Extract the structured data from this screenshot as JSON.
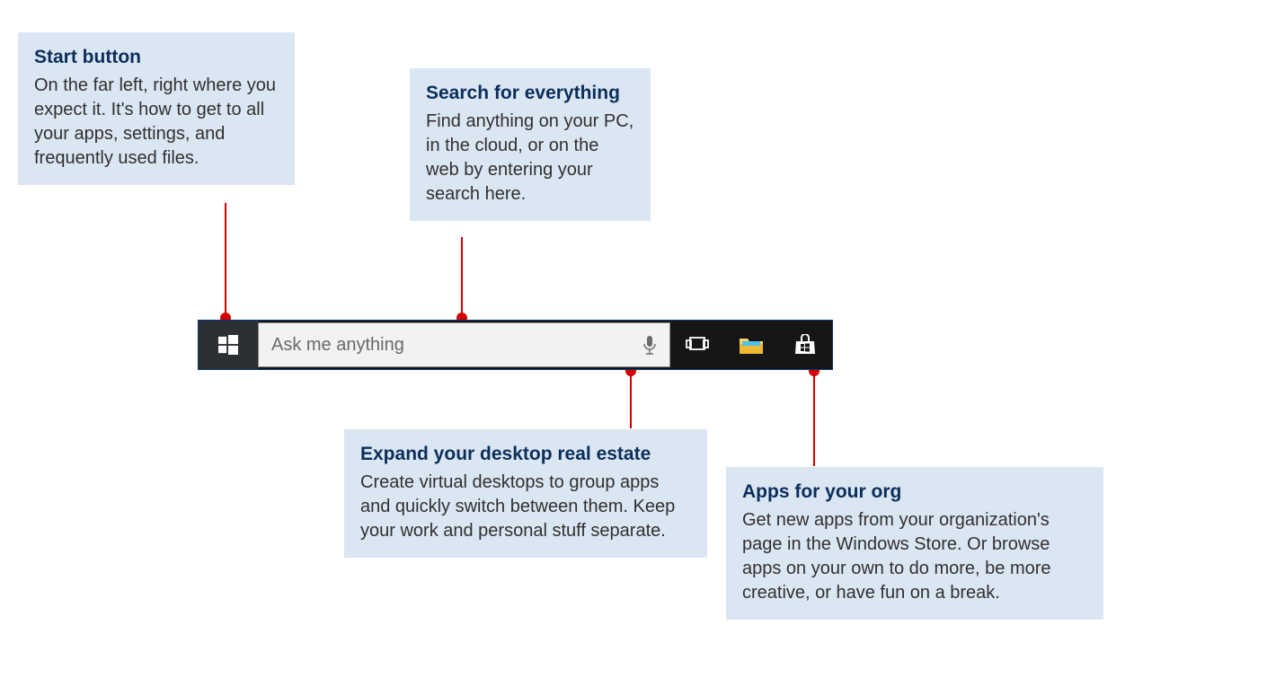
{
  "callouts": {
    "start": {
      "title": "Start button",
      "body": "On the far left, right where you expect it. It's how to get to all your apps, settings, and frequently used files."
    },
    "search": {
      "title": "Search for everything",
      "body": "Find anything on your PC, in the cloud, or on the web by entering your search here."
    },
    "desktop": {
      "title": "Expand your desktop real estate",
      "body": "Create virtual desktops to group apps and quickly switch between them. Keep your work and personal stuff separate."
    },
    "apps": {
      "title": "Apps for your org",
      "body": "Get new apps from your organization's page in the Windows Store. Or browse apps on your own to do more, be more creative, or have fun on a break."
    }
  },
  "taskbar": {
    "search_placeholder": "Ask me anything"
  }
}
